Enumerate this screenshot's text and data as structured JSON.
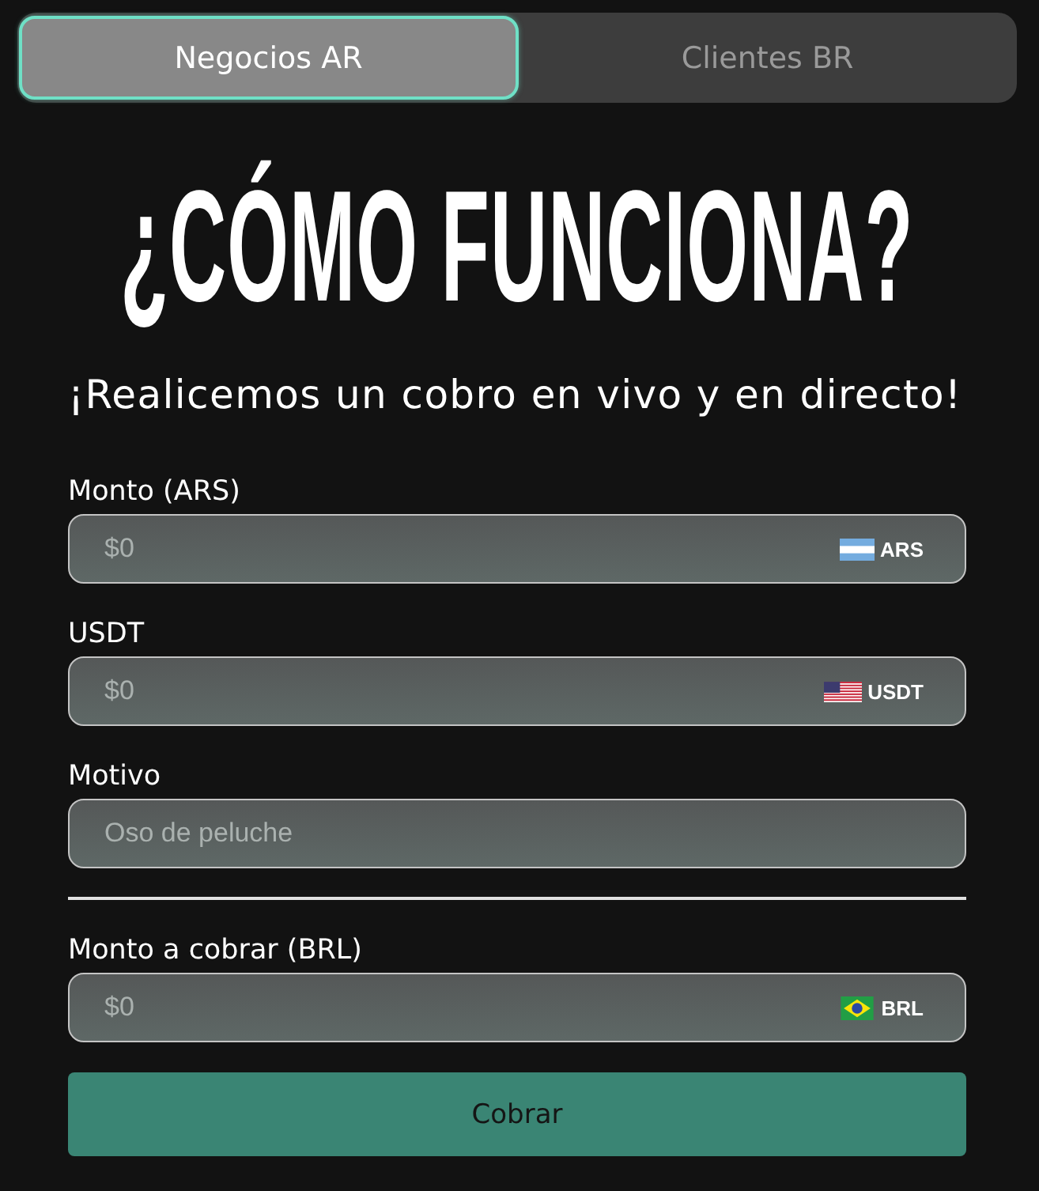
{
  "tabs": [
    {
      "label": "Negocios AR",
      "selected": true
    },
    {
      "label": "Clientes BR",
      "selected": false
    }
  ],
  "heading": "¿CÓMO FUNCIONA?",
  "subheading": "¡Realicemos un cobro en vivo y en directo!",
  "form": {
    "fields": [
      {
        "kind": "currency",
        "label": "Monto (ARS)",
        "placeholder": "$0",
        "currency": "ARS"
      },
      {
        "kind": "currency",
        "label": "USDT",
        "placeholder": "$0",
        "currency": "USDT"
      },
      {
        "kind": "text",
        "label": "Motivo",
        "placeholder": "Oso de peluche"
      }
    ],
    "result_field": {
      "label": "Monto a cobrar (BRL)",
      "placeholder": "$0",
      "currency": "BRL"
    },
    "submit_button": "Cobrar"
  }
}
